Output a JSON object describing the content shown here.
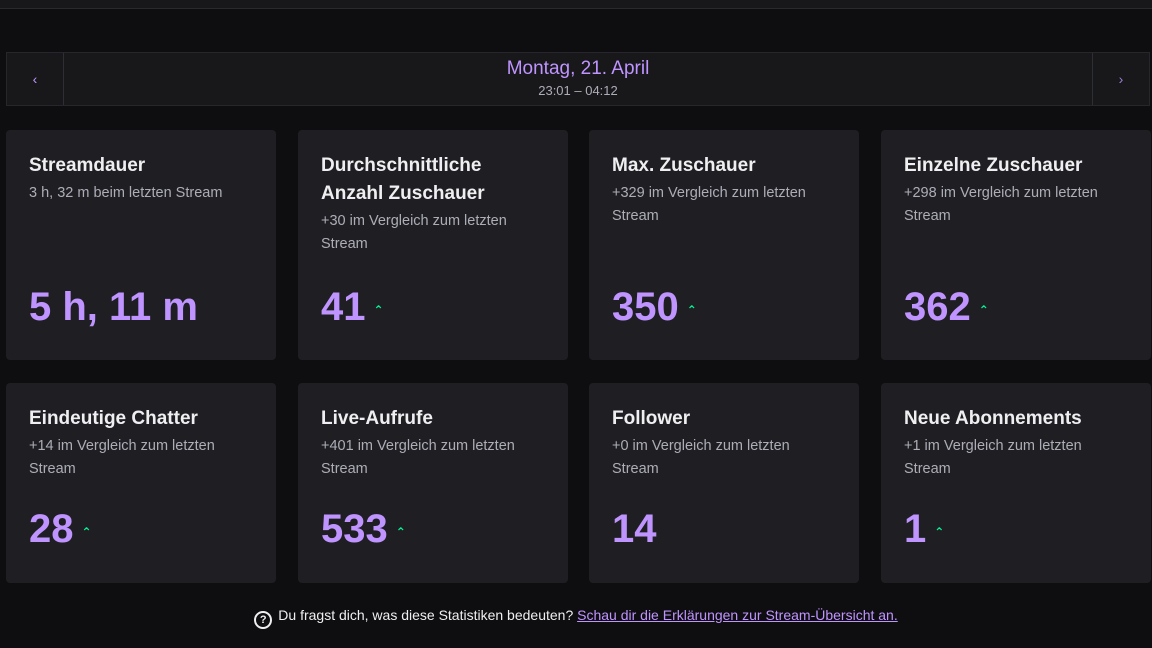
{
  "header": {
    "date": "Montag, 21. April",
    "time_range": "23:01 – 04:12",
    "prev_icon": "chevron-left-icon",
    "next_icon": "chevron-right-icon"
  },
  "stats": [
    {
      "title": "Streamdauer",
      "sub": "3 h, 32 m beim letzten Stream",
      "value": "5 h, 11 m",
      "trend": ""
    },
    {
      "title": "Durchschnittliche Anzahl Zuschauer",
      "sub": "+30 im Vergleich zum letzten Stream",
      "value": "41",
      "trend": "up"
    },
    {
      "title": "Max. Zuschauer",
      "sub": "+329 im Vergleich zum letzten Stream",
      "value": "350",
      "trend": "up"
    },
    {
      "title": "Einzelne Zuschauer",
      "sub": "+298 im Vergleich zum letzten Stream",
      "value": "362",
      "trend": "up"
    },
    {
      "title": "Eindeutige Chatter",
      "sub": "+14 im Vergleich zum letzten Stream",
      "value": "28",
      "trend": "up"
    },
    {
      "title": "Live-Aufrufe",
      "sub": "+401 im Vergleich zum letzten Stream",
      "value": "533",
      "trend": "up"
    },
    {
      "title": "Follower",
      "sub": "+0 im Vergleich zum letzten Stream",
      "value": "14",
      "trend": ""
    },
    {
      "title": "Neue Abonnements",
      "sub": "+1 im Vergleich zum letzten Stream",
      "value": "1",
      "trend": "up"
    }
  ],
  "footer": {
    "question": "Du fragst dich, was diese Statistiken bedeuten?",
    "link": "Schau dir die Erklärungen zur Stream-Übersicht an."
  },
  "colors": {
    "accent": "#bf94ff",
    "trend_up": "#00f593",
    "card_bg": "#1f1f23",
    "page_bg": "#0e0e10"
  }
}
